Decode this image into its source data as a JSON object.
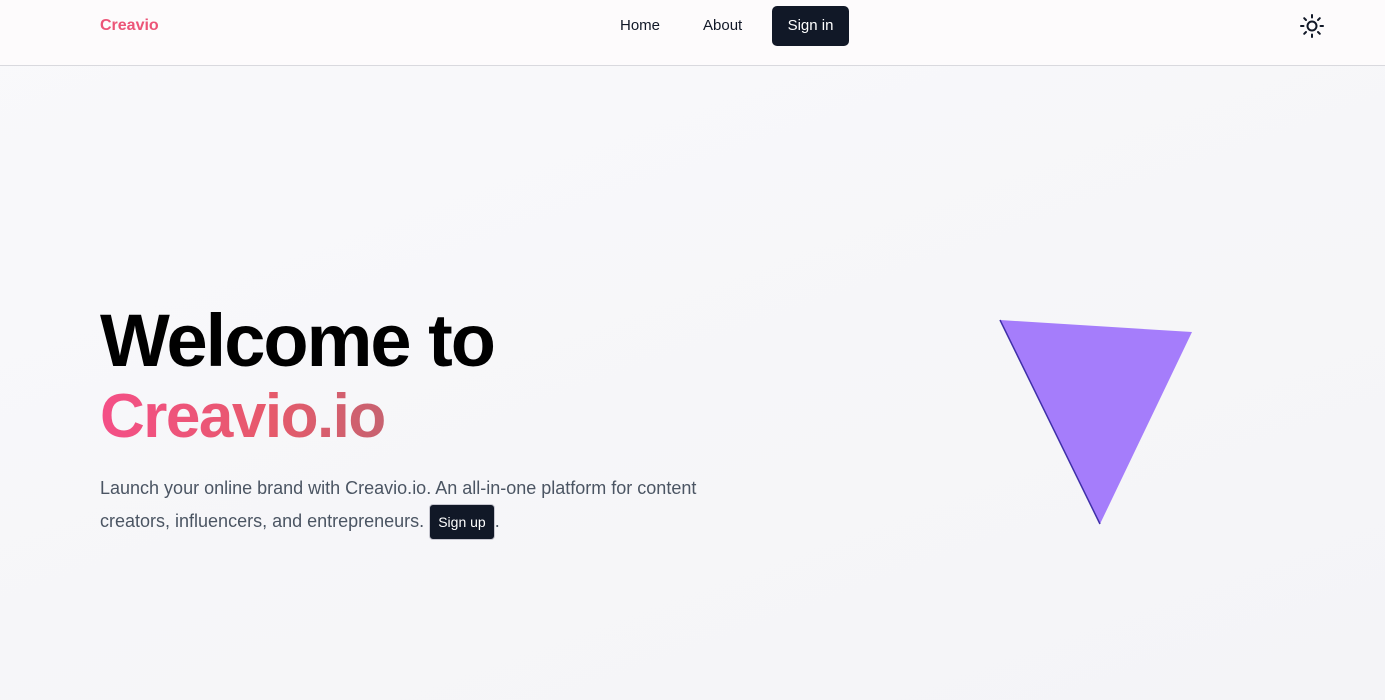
{
  "nav": {
    "brand": "Creavio",
    "links": [
      {
        "label": "Home"
      },
      {
        "label": "About"
      }
    ],
    "signin_label": "Sign in",
    "theme_toggle_icon": "sun-icon"
  },
  "hero": {
    "title": "Welcome to",
    "brand": "Creavio.io",
    "description": "Launch your online brand with Creavio.io. An all-in-one platform for content creators, influencers, and entrepreneurs.",
    "signup_label": "Sign up",
    "trailing_punct": "."
  },
  "colors": {
    "brand_pink": "#ec5477",
    "dark_button": "#111827",
    "triangle_fill": "#a57dfb",
    "triangle_edge": "#3f2fa8"
  }
}
